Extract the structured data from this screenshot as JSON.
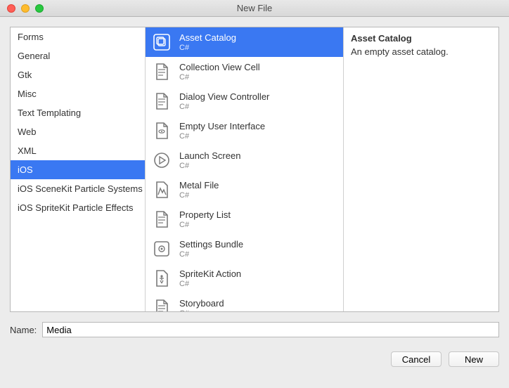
{
  "window": {
    "title": "New File"
  },
  "categories": [
    {
      "label": "Forms",
      "selected": false
    },
    {
      "label": "General",
      "selected": false
    },
    {
      "label": "Gtk",
      "selected": false
    },
    {
      "label": "Misc",
      "selected": false
    },
    {
      "label": "Text Templating",
      "selected": false
    },
    {
      "label": "Web",
      "selected": false
    },
    {
      "label": "XML",
      "selected": false
    },
    {
      "label": "iOS",
      "selected": true
    },
    {
      "label": "iOS SceneKit Particle Systems",
      "selected": false
    },
    {
      "label": "iOS SpriteKit Particle Effects",
      "selected": false
    }
  ],
  "templates": [
    {
      "name": "Asset Catalog",
      "sub": "C#",
      "icon": "catalog",
      "selected": true
    },
    {
      "name": "Collection View Cell",
      "sub": "C#",
      "icon": "file",
      "selected": false
    },
    {
      "name": "Dialog View Controller",
      "sub": "C#",
      "icon": "file",
      "selected": false
    },
    {
      "name": "Empty User Interface",
      "sub": "C#",
      "icon": "file-eye",
      "selected": false
    },
    {
      "name": "Launch Screen",
      "sub": "C#",
      "icon": "play",
      "selected": false
    },
    {
      "name": "Metal File",
      "sub": "C#",
      "icon": "metal",
      "selected": false
    },
    {
      "name": "Property List",
      "sub": "C#",
      "icon": "file",
      "selected": false
    },
    {
      "name": "Settings Bundle",
      "sub": "C#",
      "icon": "gear",
      "selected": false
    },
    {
      "name": "SpriteKit Action",
      "sub": "C#",
      "icon": "action",
      "selected": false
    },
    {
      "name": "Storyboard",
      "sub": "C#",
      "icon": "file",
      "selected": false
    }
  ],
  "detail": {
    "title": "Asset Catalog",
    "description": "An empty asset catalog."
  },
  "name_field": {
    "label": "Name:",
    "value": "Media"
  },
  "buttons": {
    "cancel": "Cancel",
    "new": "New"
  },
  "icons": {
    "catalog": "catalog",
    "file": "file",
    "file-eye": "file-eye",
    "play": "play",
    "metal": "metal",
    "gear": "gear",
    "action": "action"
  }
}
